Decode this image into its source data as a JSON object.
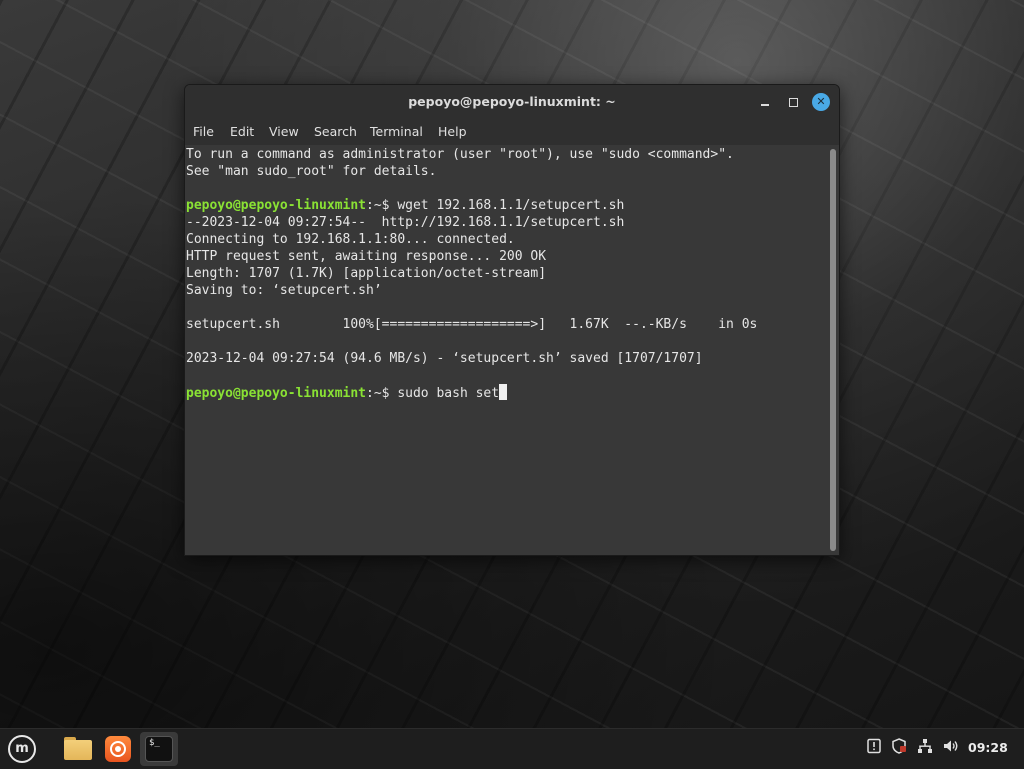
{
  "window": {
    "title": "pepoyo@pepoyo-linuxmint: ~",
    "close_symbol": "✕"
  },
  "menu": {
    "items": [
      "File",
      "Edit",
      "View",
      "Search",
      "Terminal",
      "Help"
    ]
  },
  "terminal": {
    "prompt_user": "pepoyo@pepoyo-linuxmint",
    "prompt_sep": ":~$",
    "lines": [
      "To run a command as administrator (user \"root\"), use \"sudo <command>\".",
      "See \"man sudo_root\" for details.",
      "",
      "",
      "--2023-12-04 09:27:54--  http://192.168.1.1/setupcert.sh",
      "Connecting to 192.168.1.1:80... connected.",
      "HTTP request sent, awaiting response... 200 OK",
      "Length: 1707 (1.7K) [application/octet-stream]",
      "Saving to: ‘setupcert.sh’",
      "",
      "setupcert.sh        100%[===================>]   1.67K  --.-KB/s    in 0s",
      "",
      "2023-12-04 09:27:54 (94.6 MB/s) - ‘setupcert.sh’ saved [1707/1707]"
    ],
    "command1": " wget 192.168.1.1/setupcert.sh",
    "command2": " sudo bash set"
  },
  "taskbar": {
    "menu_logo": "m",
    "terminal_icon_text": "$_",
    "clock": "09:28",
    "tray_icons": [
      "update-manager-icon",
      "shield-icon",
      "network-icon",
      "volume-icon"
    ]
  },
  "colors": {
    "prompt_green": "#8ae234",
    "close_button_blue": "#49a9e6",
    "terminal_bg": "#383838"
  }
}
